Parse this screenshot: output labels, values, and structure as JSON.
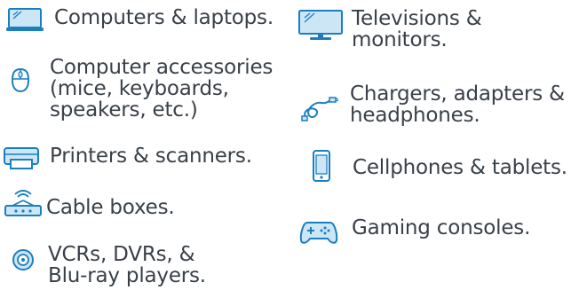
{
  "accent_color": "#1a7fbf",
  "text_color": "#3a4048",
  "left_column": [
    {
      "icon": "laptop-icon",
      "lines": [
        "Computers & laptops."
      ]
    },
    {
      "icon": "mouse-icon",
      "lines": [
        "Computer accessories",
        "(mice, keyboards,",
        "speakers, etc.)"
      ]
    },
    {
      "icon": "printer-icon",
      "lines": [
        "Printers & scanners."
      ]
    },
    {
      "icon": "cable-box-icon",
      "lines": [
        "Cable boxes."
      ]
    },
    {
      "icon": "disc-player-icon",
      "lines": [
        "VCRs, DVRs, &",
        "Blu-ray players."
      ]
    }
  ],
  "right_column": [
    {
      "icon": "television-icon",
      "lines": [
        "Televisions &",
        "monitors."
      ]
    },
    {
      "icon": "charger-cable-icon",
      "lines": [
        "Chargers, adapters &",
        "headphones."
      ]
    },
    {
      "icon": "cellphone-icon",
      "lines": [
        "Cellphones & tablets."
      ]
    },
    {
      "icon": "game-controller-icon",
      "lines": [
        "Gaming consoles."
      ]
    }
  ]
}
